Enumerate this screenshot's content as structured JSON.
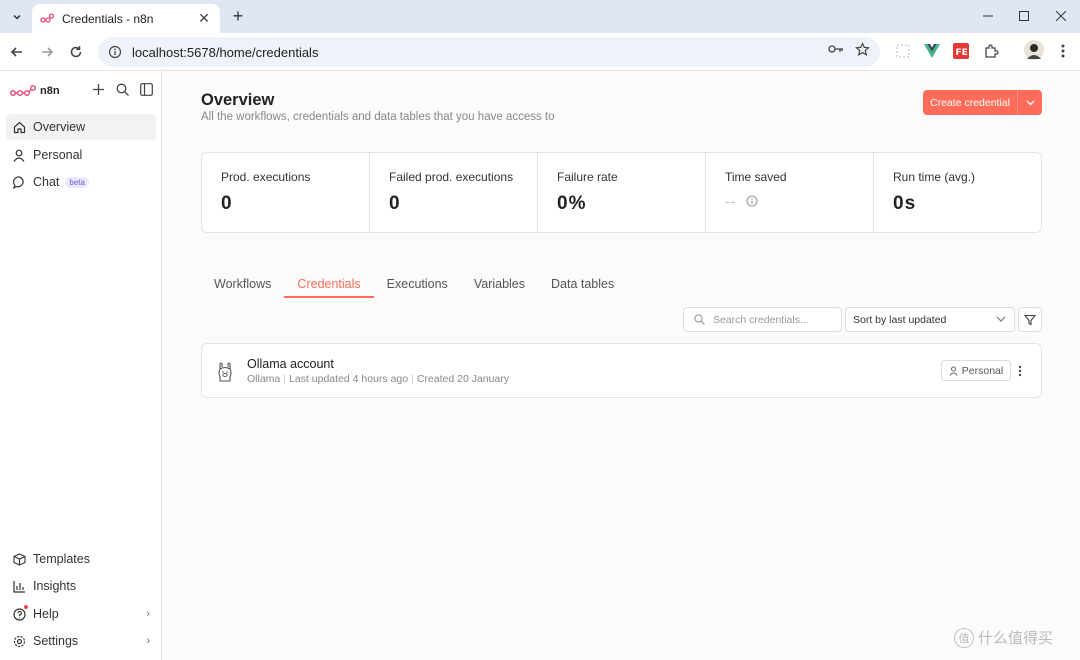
{
  "browser": {
    "tab_title": "Credentials - n8n",
    "url": "localhost:5678/home/credentials"
  },
  "sidebar": {
    "brand": "n8n",
    "top_items": [
      {
        "label": "Overview"
      },
      {
        "label": "Personal"
      },
      {
        "label": "Chat",
        "badge": "beta"
      }
    ],
    "bottom_items": [
      {
        "label": "Templates"
      },
      {
        "label": "Insights"
      },
      {
        "label": "Help"
      },
      {
        "label": "Settings"
      }
    ]
  },
  "header": {
    "title": "Overview",
    "subtitle": "All the workflows, credentials and data tables that you have access to",
    "create_button": "Create credential"
  },
  "stats": [
    {
      "label": "Prod. executions",
      "value": "0"
    },
    {
      "label": "Failed prod. executions",
      "value": "0"
    },
    {
      "label": "Failure rate",
      "value": "0%"
    },
    {
      "label": "Time saved",
      "value": "--"
    },
    {
      "label": "Run time (avg.)",
      "value": "0s"
    }
  ],
  "tabs": [
    "Workflows",
    "Credentials",
    "Executions",
    "Variables",
    "Data tables"
  ],
  "active_tab": "Credentials",
  "search": {
    "placeholder": "Search credentials..."
  },
  "sort": {
    "selected": "Sort by last updated"
  },
  "credentials": [
    {
      "name": "Ollama account",
      "type": "Ollama",
      "updated": "Last updated 4 hours ago",
      "created": "Created 20 January",
      "owner": "Personal"
    }
  ],
  "watermark": "什么值得买",
  "colors": {
    "accent": "#ff6d5a",
    "chrome": "#dfe7f5"
  }
}
